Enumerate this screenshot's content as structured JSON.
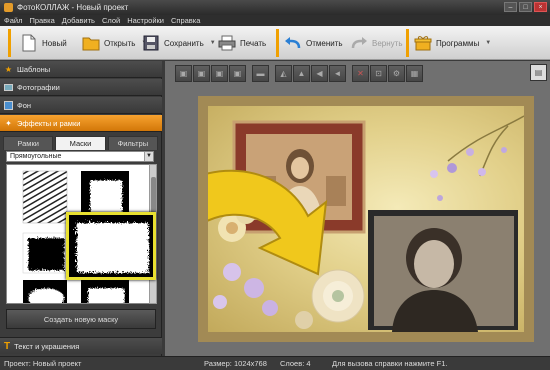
{
  "window": {
    "title": "ФотоКОЛЛАЖ - Новый проект"
  },
  "menu": [
    "Файл",
    "Правка",
    "Добавить",
    "Слой",
    "Настройки",
    "Справка"
  ],
  "toolbar": {
    "new_label": "Новый",
    "open_label": "Открыть",
    "save_label": "Сохранить",
    "print_label": "Печать",
    "undo_label": "Отменить",
    "redo_label": "Вернуть",
    "programs_label": "Программы"
  },
  "sidebar": {
    "items": [
      {
        "label": "Шаблоны",
        "icon": "star-icon"
      },
      {
        "label": "Фотографии",
        "icon": "photo-icon"
      },
      {
        "label": "Фон",
        "icon": "background-icon"
      },
      {
        "label": "Эффекты и рамки",
        "icon": "effects-icon"
      }
    ],
    "tabs": [
      "Рамки",
      "Маски",
      "Фильтры"
    ],
    "active_tab": "Маски",
    "mask_type": "Прямоугольные",
    "create_mask_label": "Создать новую маску",
    "bottom_item": "Текст и украшения"
  },
  "status": {
    "project": "Проект: Новый проект",
    "size": "Размер: 1024x768",
    "layers": "Слоев: 4",
    "help": "Для вызова справки нажмите F1."
  },
  "colors": {
    "accent": "#f0a000",
    "dark_bg": "#3c3c3c"
  }
}
